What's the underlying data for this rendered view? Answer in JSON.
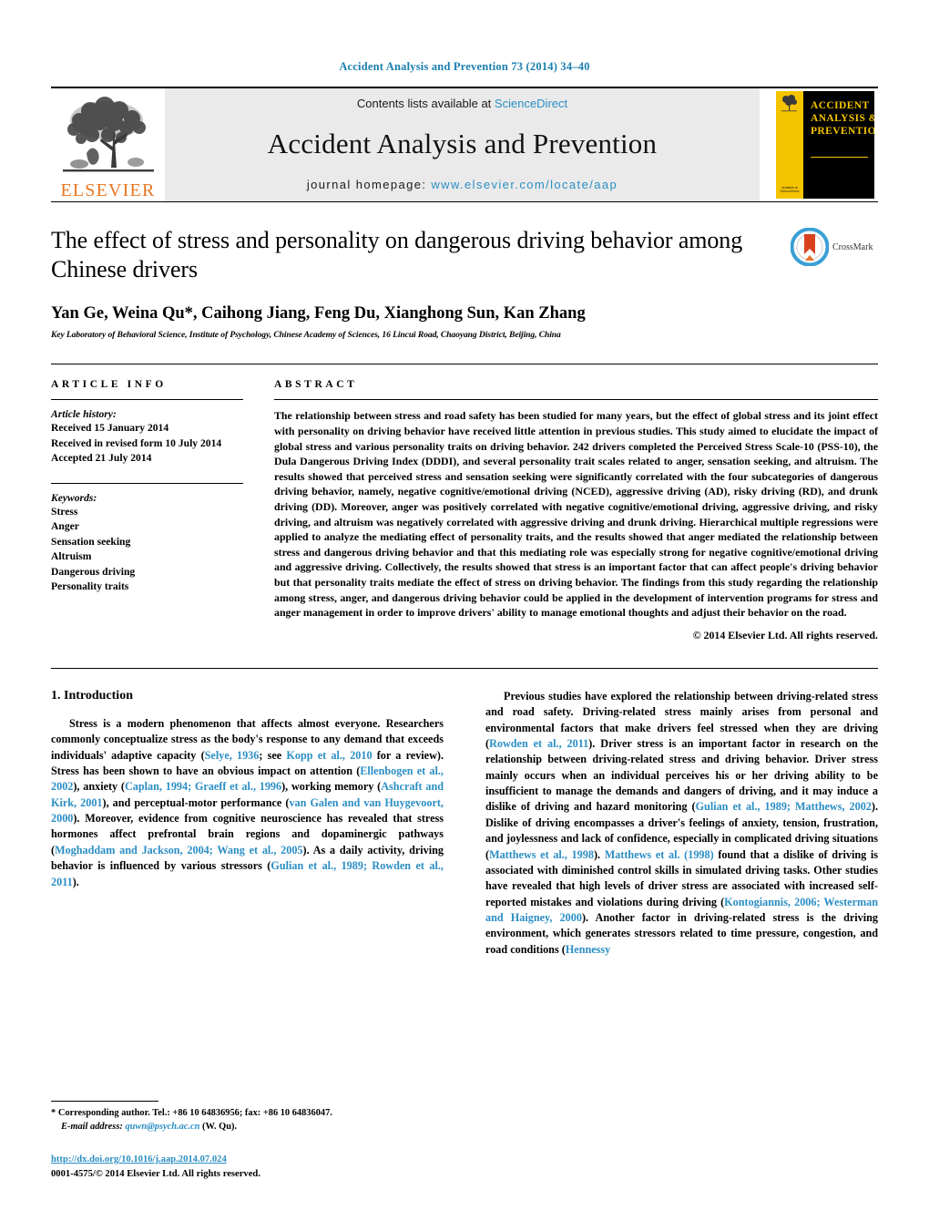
{
  "running_head": "Accident Analysis and Prevention 73 (2014) 34–40",
  "masthead": {
    "publisher_name": "ELSEVIER",
    "contents_prefix": "Contents lists available at",
    "contents_link": "ScienceDirect",
    "journal_name": "Accident Analysis and Prevention",
    "homepage_prefix": "journal homepage:",
    "homepage_url": "www.elsevier.com/locate/aap",
    "cover_title": "ACCIDENT ANALYSIS & PREVENTION",
    "cover_footer": "available at ScienceDirect",
    "link_color": "#2b8ec4",
    "panel_color": "#eaeaea",
    "brand_orange": "#e87722",
    "cover_yellow": "#f5c400"
  },
  "article": {
    "title": "The effect of stress and personality on dangerous driving behavior among Chinese drivers",
    "authors": "Yan Ge, Weina Qu*, Caihong Jiang, Feng Du, Xianghong Sun, Kan Zhang",
    "affiliation": "Key Laboratory of Behavioral Science, Institute of Psychology, Chinese Academy of Sciences, 16 Lincui Road, Chaoyang District, Beijing, China",
    "crossmark_label": "CrossMark"
  },
  "article_info": {
    "heading": "ARTICLE INFO",
    "history_label": "Article history:",
    "history": [
      "Received 15 January 2014",
      "Received in revised form 10 July 2014",
      "Accepted 21 July 2014"
    ],
    "keywords_label": "Keywords:",
    "keywords": [
      "Stress",
      "Anger",
      "Sensation seeking",
      "Altruism",
      "Dangerous driving",
      "Personality traits"
    ]
  },
  "abstract": {
    "heading": "ABSTRACT",
    "text": "The relationship between stress and road safety has been studied for many years, but the effect of global stress and its joint effect with personality on driving behavior have received little attention in previous studies. This study aimed to elucidate the impact of global stress and various personality traits on driving behavior. 242 drivers completed the Perceived Stress Scale-10 (PSS-10), the Dula Dangerous Driving Index (DDDI), and several personality trait scales related to anger, sensation seeking, and altruism. The results showed that perceived stress and sensation seeking were significantly correlated with the four subcategories of dangerous driving behavior, namely, negative cognitive/emotional driving (NCED), aggressive driving (AD), risky driving (RD), and drunk driving (DD). Moreover, anger was positively correlated with negative cognitive/emotional driving, aggressive driving, and risky driving, and altruism was negatively correlated with aggressive driving and drunk driving. Hierarchical multiple regressions were applied to analyze the mediating effect of personality traits, and the results showed that anger mediated the relationship between stress and dangerous driving behavior and that this mediating role was especially strong for negative cognitive/emotional driving and aggressive driving. Collectively, the results showed that stress is an important factor that can affect people's driving behavior but that personality traits mediate the effect of stress on driving behavior. The findings from this study regarding the relationship among stress, anger, and dangerous driving behavior could be applied in the development of intervention programs for stress and anger management in order to improve drivers' ability to manage emotional thoughts and adjust their behavior on the road.",
    "copyright": "© 2014 Elsevier Ltd. All rights reserved."
  },
  "introduction": {
    "section_title": "1. Introduction",
    "left_paragraph_parts": [
      {
        "t": "Stress is a modern phenomenon that affects almost everyone. Researchers commonly conceptualize stress as the body's response to any demand that exceeds individuals' adaptive capacity ("
      },
      {
        "t": "Selye, 1936",
        "ref": true
      },
      {
        "t": "; see "
      },
      {
        "t": "Kopp et al., 2010",
        "ref": true
      },
      {
        "t": " for a review). Stress has been shown to have an obvious impact on attention ("
      },
      {
        "t": "Ellenbogen et al., 2002",
        "ref": true
      },
      {
        "t": "), anxiety ("
      },
      {
        "t": "Caplan, 1994; Graeff et al., 1996",
        "ref": true
      },
      {
        "t": "), working memory ("
      },
      {
        "t": "Ashcraft and Kirk, 2001",
        "ref": true
      },
      {
        "t": "), and perceptual-motor performance ("
      },
      {
        "t": "van Galen and van Huygevoort, 2000",
        "ref": true
      },
      {
        "t": "). Moreover, evidence from cognitive neuroscience has revealed that stress hormones affect prefrontal brain regions and dopaminergic pathways ("
      },
      {
        "t": "Moghaddam and Jackson, 2004; Wang et al., 2005",
        "ref": true
      },
      {
        "t": "). As a daily activity, driving behavior is influenced by various stressors ("
      },
      {
        "t": "Gulian et al., 1989; Rowden et al., 2011",
        "ref": true
      },
      {
        "t": ")."
      }
    ],
    "right_paragraph_parts": [
      {
        "t": "Previous studies have explored the relationship between driving-related stress and road safety. Driving-related stress mainly arises from personal and environmental factors that make drivers feel stressed when they are driving ("
      },
      {
        "t": "Rowden et al., 2011",
        "ref": true
      },
      {
        "t": "). Driver stress is an important factor in research on the relationship between driving-related stress and driving behavior. Driver stress mainly occurs when an individual perceives his or her driving ability to be insufficient to manage the demands and dangers of driving, and it may induce a dislike of driving and hazard monitoring ("
      },
      {
        "t": "Gulian et al., 1989; Matthews, 2002",
        "ref": true
      },
      {
        "t": "). Dislike of driving encompasses a driver's feelings of anxiety, tension, frustration, and joylessness and lack of confidence, especially in complicated driving situations ("
      },
      {
        "t": "Matthews et al., 1998",
        "ref": true
      },
      {
        "t": "). "
      },
      {
        "t": "Matthews et al. (1998)",
        "ref": true
      },
      {
        "t": " found that a dislike of driving is associated with diminished control skills in simulated driving tasks. Other studies have revealed that high levels of driver stress are associated with increased self-reported mistakes and violations during driving ("
      },
      {
        "t": "Kontogiannis, 2006; Westerman and Haigney, 2000",
        "ref": true
      },
      {
        "t": "). Another factor in driving-related stress is the driving environment, which generates stressors related to time pressure, congestion, and road conditions ("
      },
      {
        "t": "Hennessy",
        "ref": true
      }
    ]
  },
  "footer": {
    "corresponding_marker": "*",
    "corresponding_text": "Corresponding author. Tel.: +86 10 64836956; fax: +86 10 64836047.",
    "email_label": "E-mail address:",
    "email": "quwn@psych.ac.cn",
    "email_suffix": "(W. Qu).",
    "doi": "http://dx.doi.org/10.1016/j.aap.2014.07.024",
    "issn_line": "0001-4575/© 2014 Elsevier Ltd. All rights reserved."
  }
}
